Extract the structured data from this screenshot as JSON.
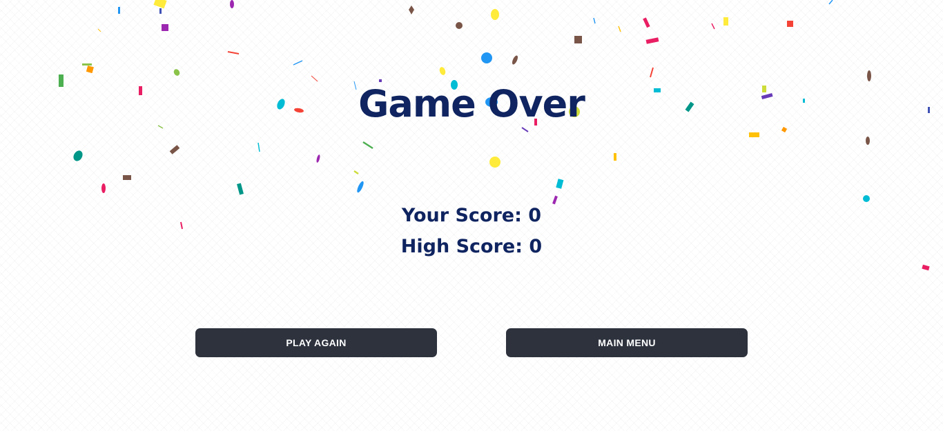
{
  "screen": {
    "title": "Game Over",
    "your_score_label": "Your Score:",
    "your_score_value": "0",
    "high_score_label": "High Score:",
    "high_score_value": "0"
  },
  "buttons": {
    "play_again": "PLAY AGAIN",
    "main_menu": "MAIN MENU"
  },
  "colors": {
    "title": "#0f2460",
    "button_bg": "#2d323d",
    "button_text": "#ffffff",
    "confetti": [
      "#e91e63",
      "#ffeb3b",
      "#2196f3",
      "#00bcd4",
      "#4caf50",
      "#ff9800",
      "#9c27b0",
      "#795548",
      "#673ab7",
      "#f44336",
      "#8bc34a",
      "#009688",
      "#cddc39",
      "#ffc107",
      "#3f51b5"
    ]
  }
}
